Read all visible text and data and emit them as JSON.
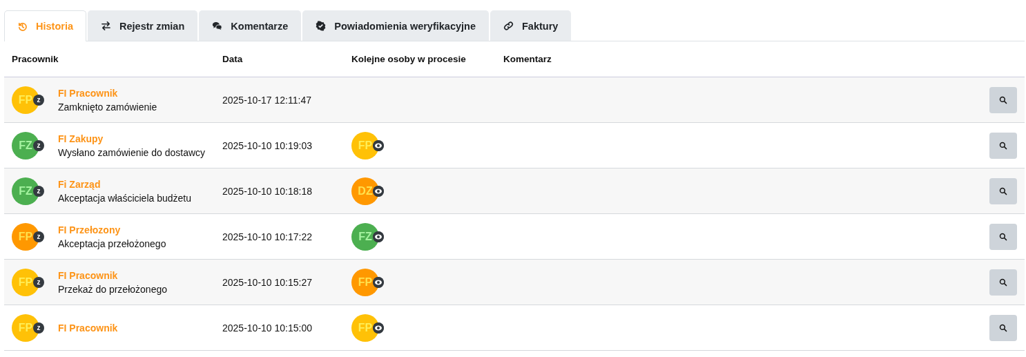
{
  "tabs": [
    {
      "label": "Historia",
      "selected": true
    },
    {
      "label": "Rejestr zmian",
      "selected": false
    },
    {
      "label": "Komentarze",
      "selected": false
    },
    {
      "label": "Powiadomienia weryfikacyjne",
      "selected": false
    },
    {
      "label": "Faktury",
      "selected": false
    }
  ],
  "table": {
    "columns": [
      "Pracownik",
      "Data",
      "Kolejne osoby w procesie",
      "Komentarz"
    ],
    "rows": [
      {
        "avatar": {
          "initials": "FP",
          "color": "#ffc107",
          "badge": "z"
        },
        "name": "FI Pracownik",
        "action": "Zamknięto zamówienie",
        "date": "2025-10-17 12:11:47"
      },
      {
        "avatar": {
          "initials": "FZ",
          "color": "#4caf50",
          "badge": "z"
        },
        "name": "FI Zakupy",
        "action": "Wysłano zamówienie do dostawcy",
        "date": "2025-10-10 10:19:03",
        "next": {
          "initials": "FP",
          "color": "#ffc107"
        }
      },
      {
        "avatar": {
          "initials": "FZ",
          "color": "#4caf50",
          "badge": "z"
        },
        "name": "Fi Zarząd",
        "action": "Akceptacja właściciela budżetu",
        "date": "2025-10-10 10:18:18",
        "next": {
          "initials": "DZ",
          "color": "#ff9800"
        }
      },
      {
        "avatar": {
          "initials": "FP",
          "color": "#ff9800",
          "badge": "z"
        },
        "name": "FI Przełozony",
        "action": "Akceptacja przełożonego",
        "date": "2025-10-10 10:17:22",
        "next": {
          "initials": "FZ",
          "color": "#4caf50"
        }
      },
      {
        "avatar": {
          "initials": "FP",
          "color": "#ffc107",
          "badge": "z"
        },
        "name": "FI Pracownik",
        "action": "Przekaż do przełożonego",
        "date": "2025-10-10 10:15:27",
        "next": {
          "initials": "FP",
          "color": "#ff9800"
        }
      },
      {
        "avatar": {
          "initials": "FP",
          "color": "#ffc107",
          "badge": "z"
        },
        "name": "FI Pracownik",
        "date": "2025-10-10 10:15:00",
        "next": {
          "initials": "FP",
          "color": "#ffc107"
        }
      }
    ]
  }
}
